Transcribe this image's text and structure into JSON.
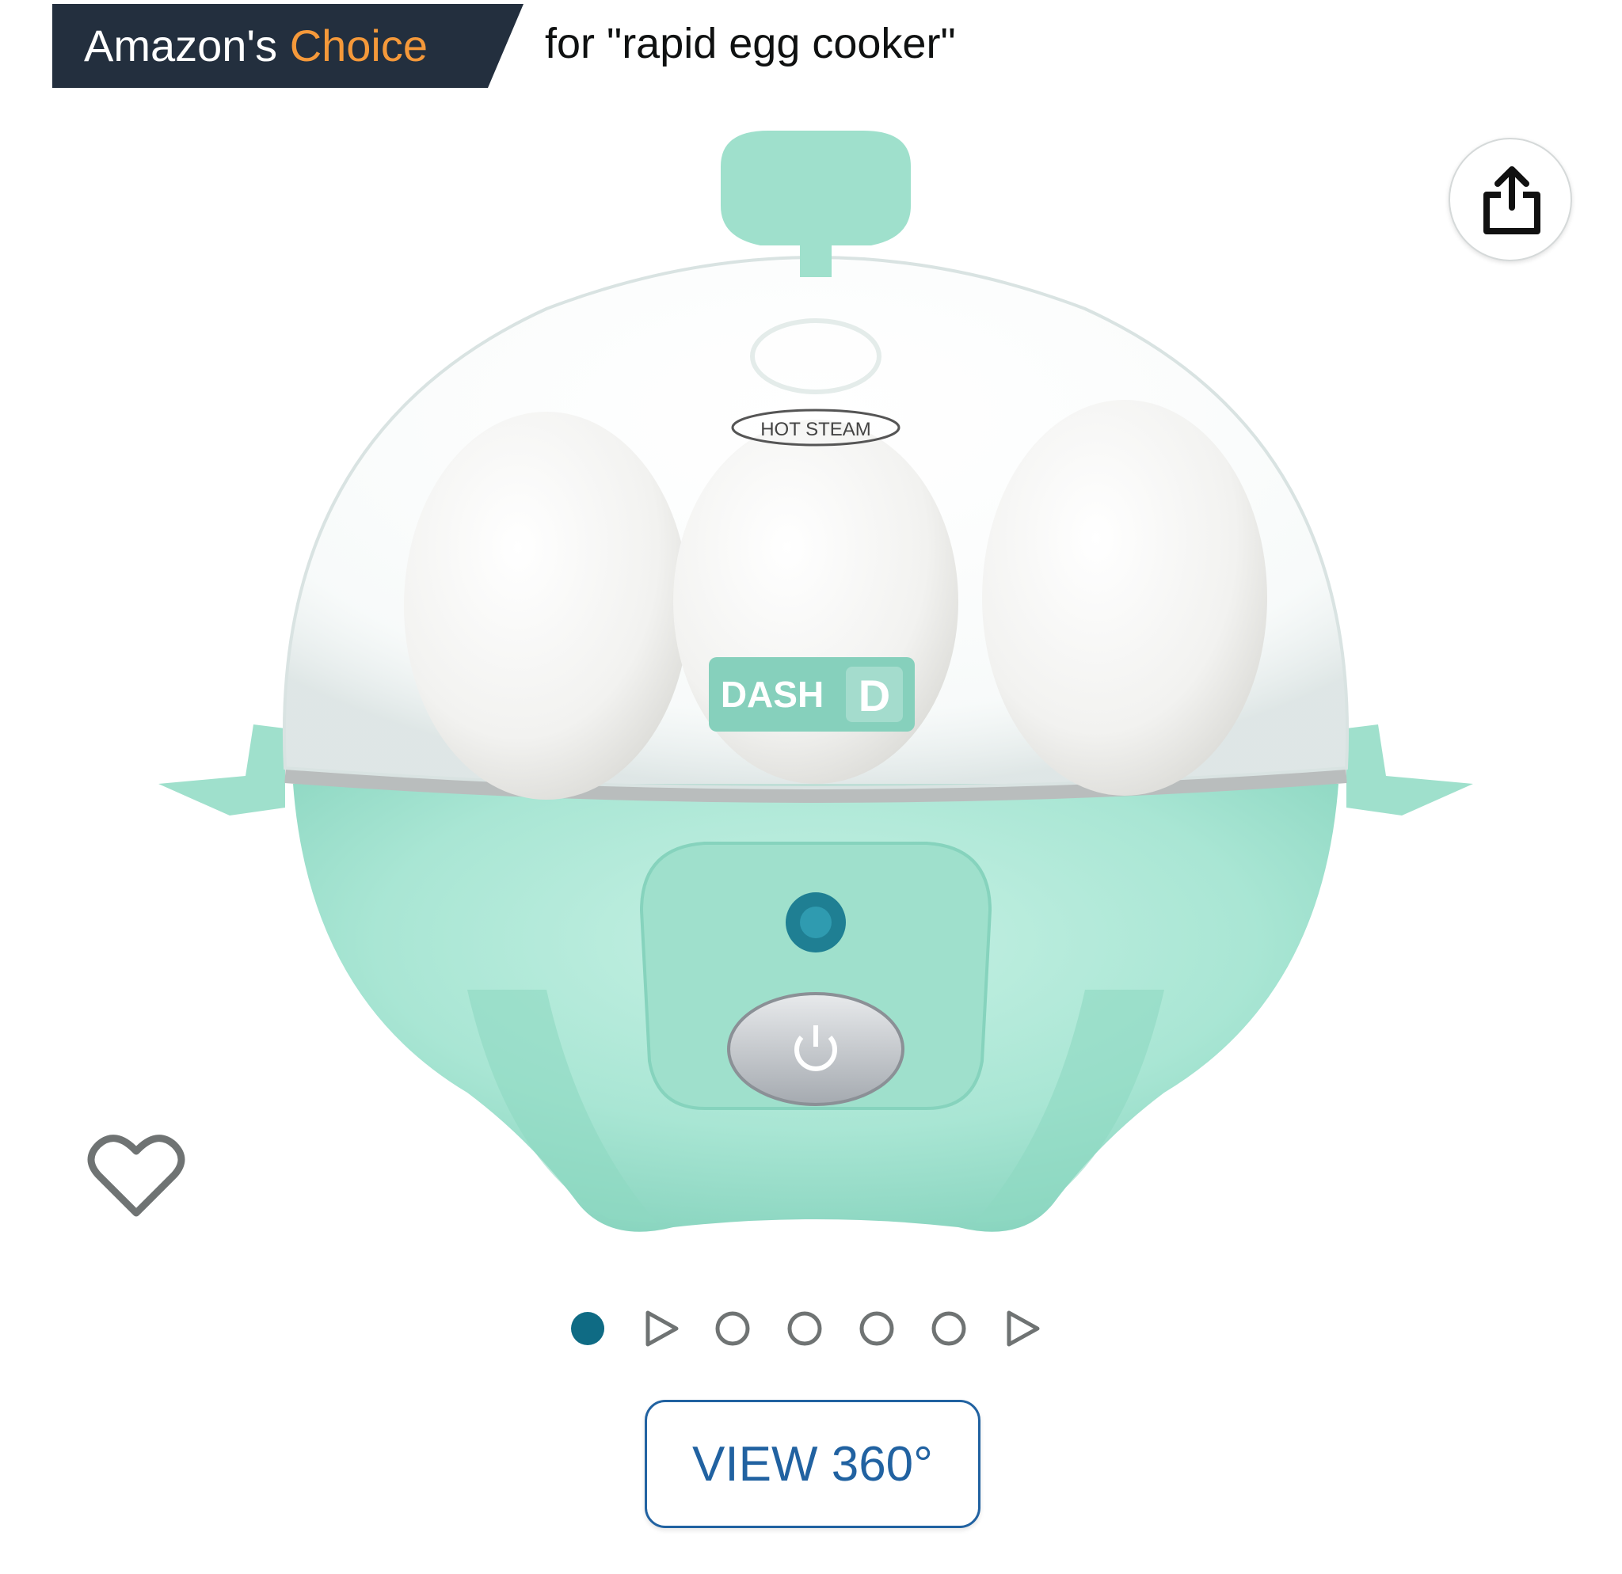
{
  "badge": {
    "brand_text": "Amazon's",
    "choice_text": "Choice",
    "context_text": "for \"rapid egg cooker\"",
    "colors": {
      "background": "#232f3e",
      "accent": "#f5993a"
    }
  },
  "product": {
    "brand_label": "DASH",
    "steam_label": "HOT STEAM",
    "colors": {
      "mint": "#a7e6d3",
      "mint_dark": "#7fcfb8",
      "indicator": "#1f7f93"
    }
  },
  "icons": {
    "share": "share-icon",
    "wishlist": "heart-icon"
  },
  "carousel": {
    "items": [
      {
        "type": "image",
        "active": true
      },
      {
        "type": "video",
        "active": false
      },
      {
        "type": "image",
        "active": false
      },
      {
        "type": "image",
        "active": false
      },
      {
        "type": "image",
        "active": false
      },
      {
        "type": "image",
        "active": false
      },
      {
        "type": "video",
        "active": false
      }
    ],
    "active_color": "#0f6b84"
  },
  "view360": {
    "label": "VIEW 360°",
    "color": "#2162a1"
  }
}
